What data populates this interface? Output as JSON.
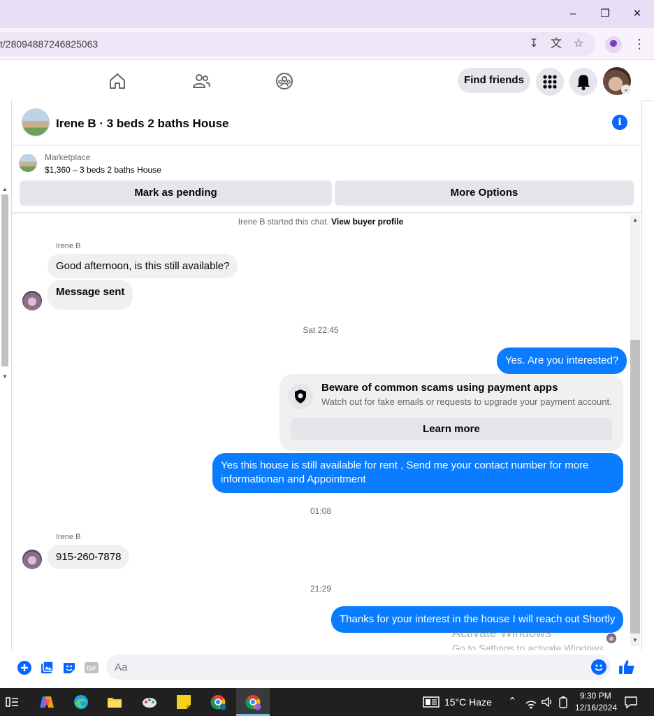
{
  "browser": {
    "url": "t/28094887246825063",
    "window_controls": [
      "minimize",
      "restore",
      "close"
    ]
  },
  "fb_header": {
    "find_friends_label": "Find friends"
  },
  "chat": {
    "title": "Irene B · 3 beds 2 baths House",
    "marketplace_label": "Marketplace",
    "listing": "$1,360 – 3 beds 2 baths House",
    "mark_pending_label": "Mark as pending",
    "more_options_label": "More Options",
    "system_text": "Irene B started this chat.",
    "view_buyer_profile": "View buyer profile",
    "messages": [
      {
        "sender": "Irene B",
        "text": "Good afternoon, is this still available?"
      },
      {
        "text": "Message sent"
      },
      {
        "timestamp": "Sat 22:45"
      },
      {
        "outgoing": true,
        "text": "Yes. Are you interested?"
      },
      {
        "outgoing": true,
        "text": "Yes this house is still available for rent , Send me your contact number for more informationan and Appointment"
      },
      {
        "timestamp": "01:08"
      },
      {
        "sender": "Irene B",
        "text": "915-260-7878"
      },
      {
        "timestamp": "21:29"
      },
      {
        "outgoing": true,
        "text": "Thanks for your interest in the house I will reach out Shortly"
      }
    ],
    "scam_notice": {
      "title": "Beware of common scams using payment apps",
      "subtitle": "Watch out for fake emails or requests to upgrade your payment account.",
      "button": "Learn more"
    },
    "composer_placeholder": "Aa"
  },
  "watermark": {
    "line1": "Activate Windows",
    "line2": "Go to Settings to activate Windows."
  },
  "taskbar": {
    "weather": "15°C  Haze",
    "time": "9:30 PM",
    "date": "12/16/2024"
  },
  "colors": {
    "accent": "#0866ff",
    "outgoing_bubble": "#0a7cff",
    "titlebar": "#e8dff7"
  }
}
